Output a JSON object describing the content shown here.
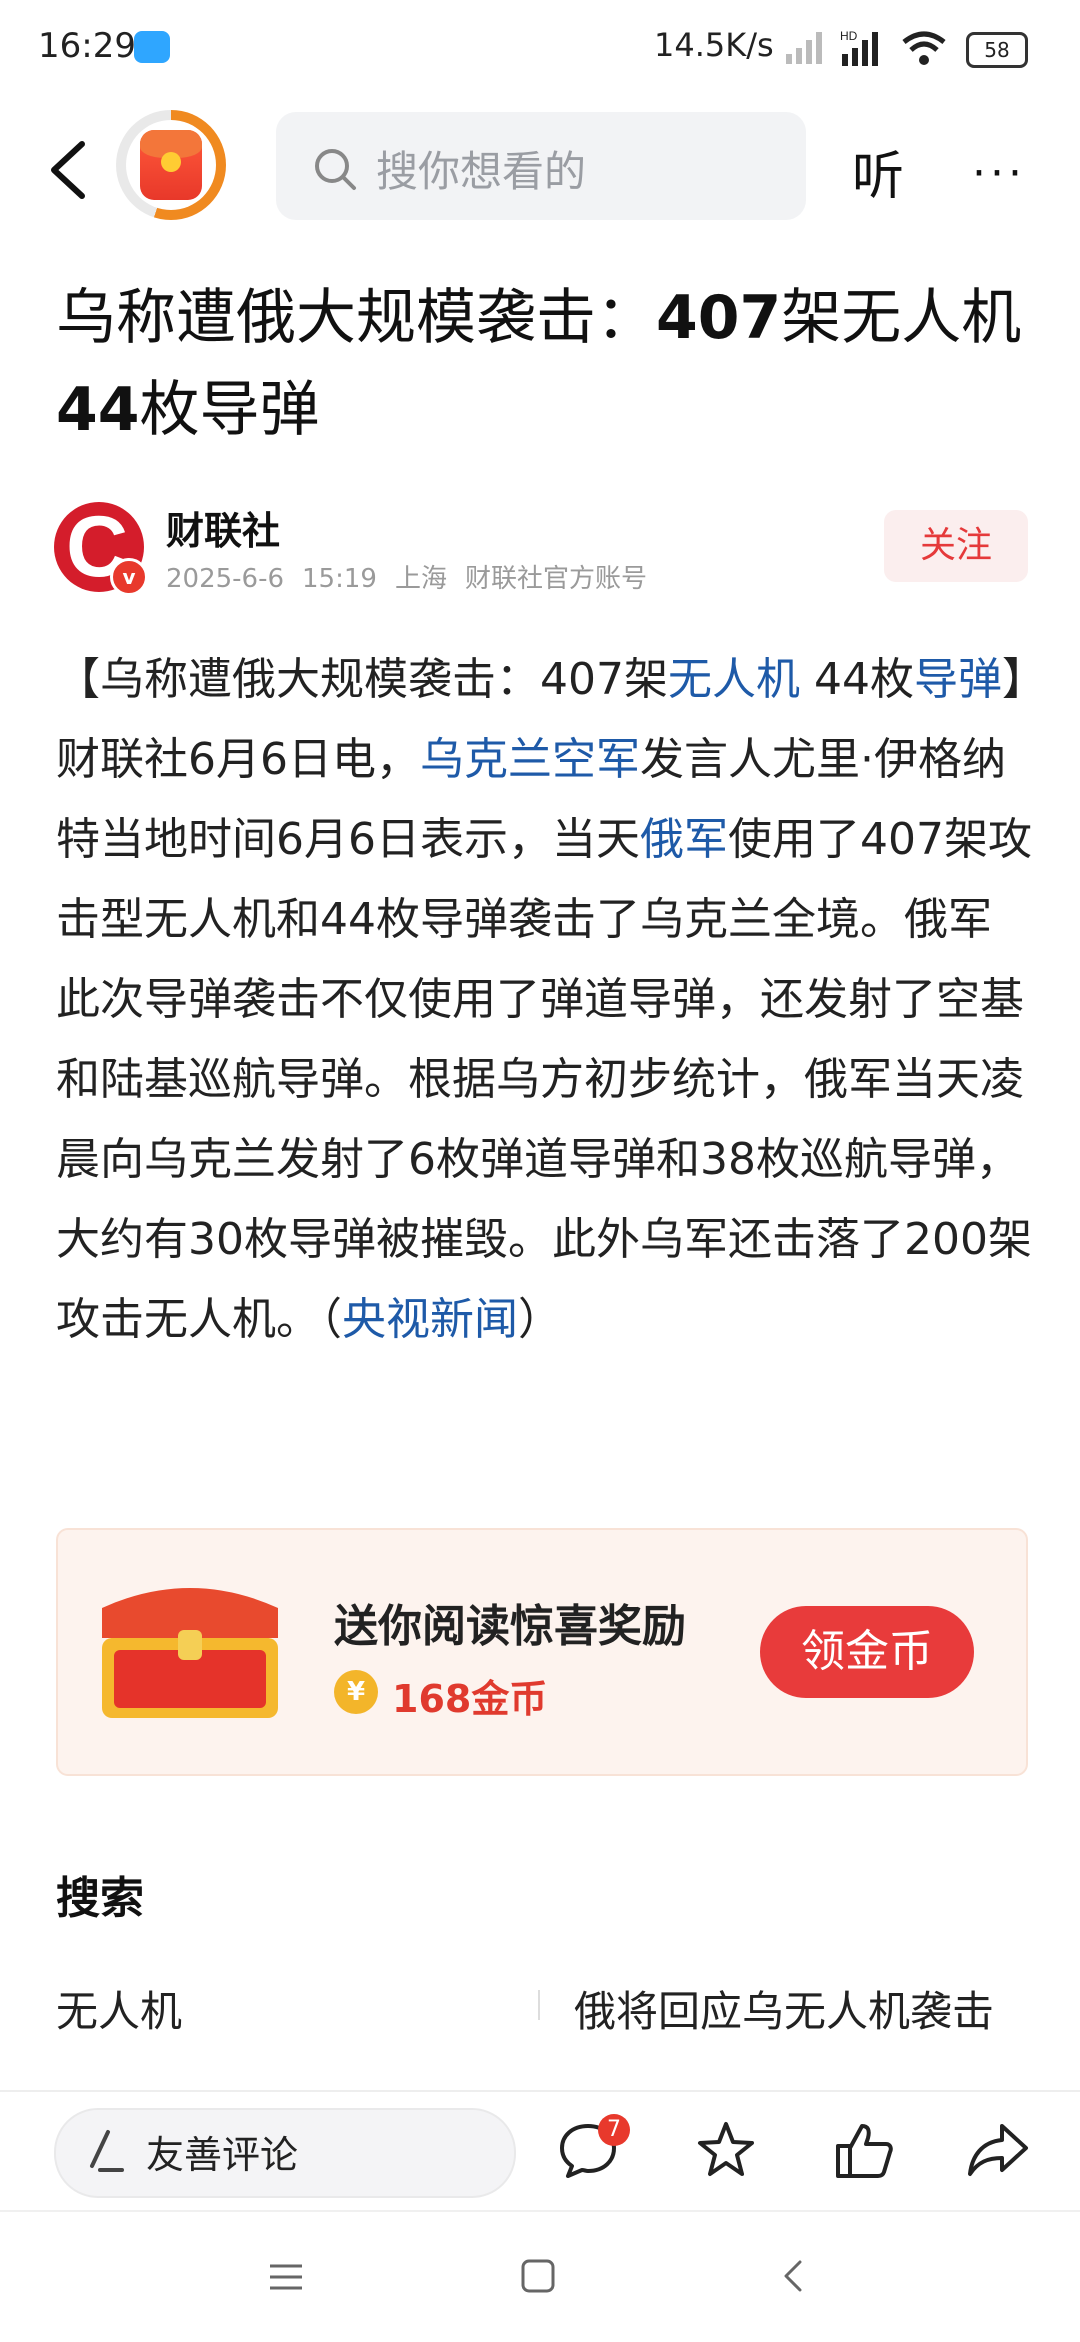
{
  "status_bar": {
    "time": "16:29",
    "net_speed": "14.5K/s",
    "battery": "58"
  },
  "header": {
    "search_placeholder": "搜你想看的",
    "listen_label": "听",
    "more_label": "···"
  },
  "article": {
    "title_parts": [
      "乌称遭俄大规模袭击：",
      "407",
      "架无人机",
      "44",
      "枚导弹"
    ],
    "author": {
      "name": "财联社",
      "avatar_letter": "C",
      "verified_badge": "v",
      "date": "2025-6-6",
      "time": "15:19",
      "location": "上海",
      "account": "财联社官方账号",
      "follow_label": "关注"
    },
    "body": {
      "p1": "【乌称遭俄大规模袭击：407架",
      "link1": "无人机",
      "p2": " 44枚",
      "link2": "导弹",
      "p3": "】财联社6月6日电，",
      "link3": "乌克兰空军",
      "p4": "发言人尤里·伊格纳特当地时间6月6日表示，当天",
      "link4": "俄军",
      "p5": "使用了407架攻击型无人机和44枚导弹袭击了乌克兰全境。俄军此次导弹袭击不仅使用了弹道导弹，还发射了空基和陆基巡航导弹。根据乌方初步统计，俄军当天凌晨向乌克兰发射了6枚弹道导弹和38枚巡航导弹，大约有30枚导弹被摧毁。此外乌军还击落了200架攻击无人机。（",
      "link5": "央视新闻",
      "p6": "）"
    }
  },
  "reward": {
    "title": "送你阅读惊喜奖励",
    "coin_symbol": "¥",
    "coins": "168金币",
    "button": "领金币"
  },
  "search_section": {
    "title": "搜索",
    "left": "无人机",
    "right": "俄将回应乌无人机袭击"
  },
  "bottom_bar": {
    "comment_placeholder": "友善评论",
    "comment_count": "7"
  }
}
